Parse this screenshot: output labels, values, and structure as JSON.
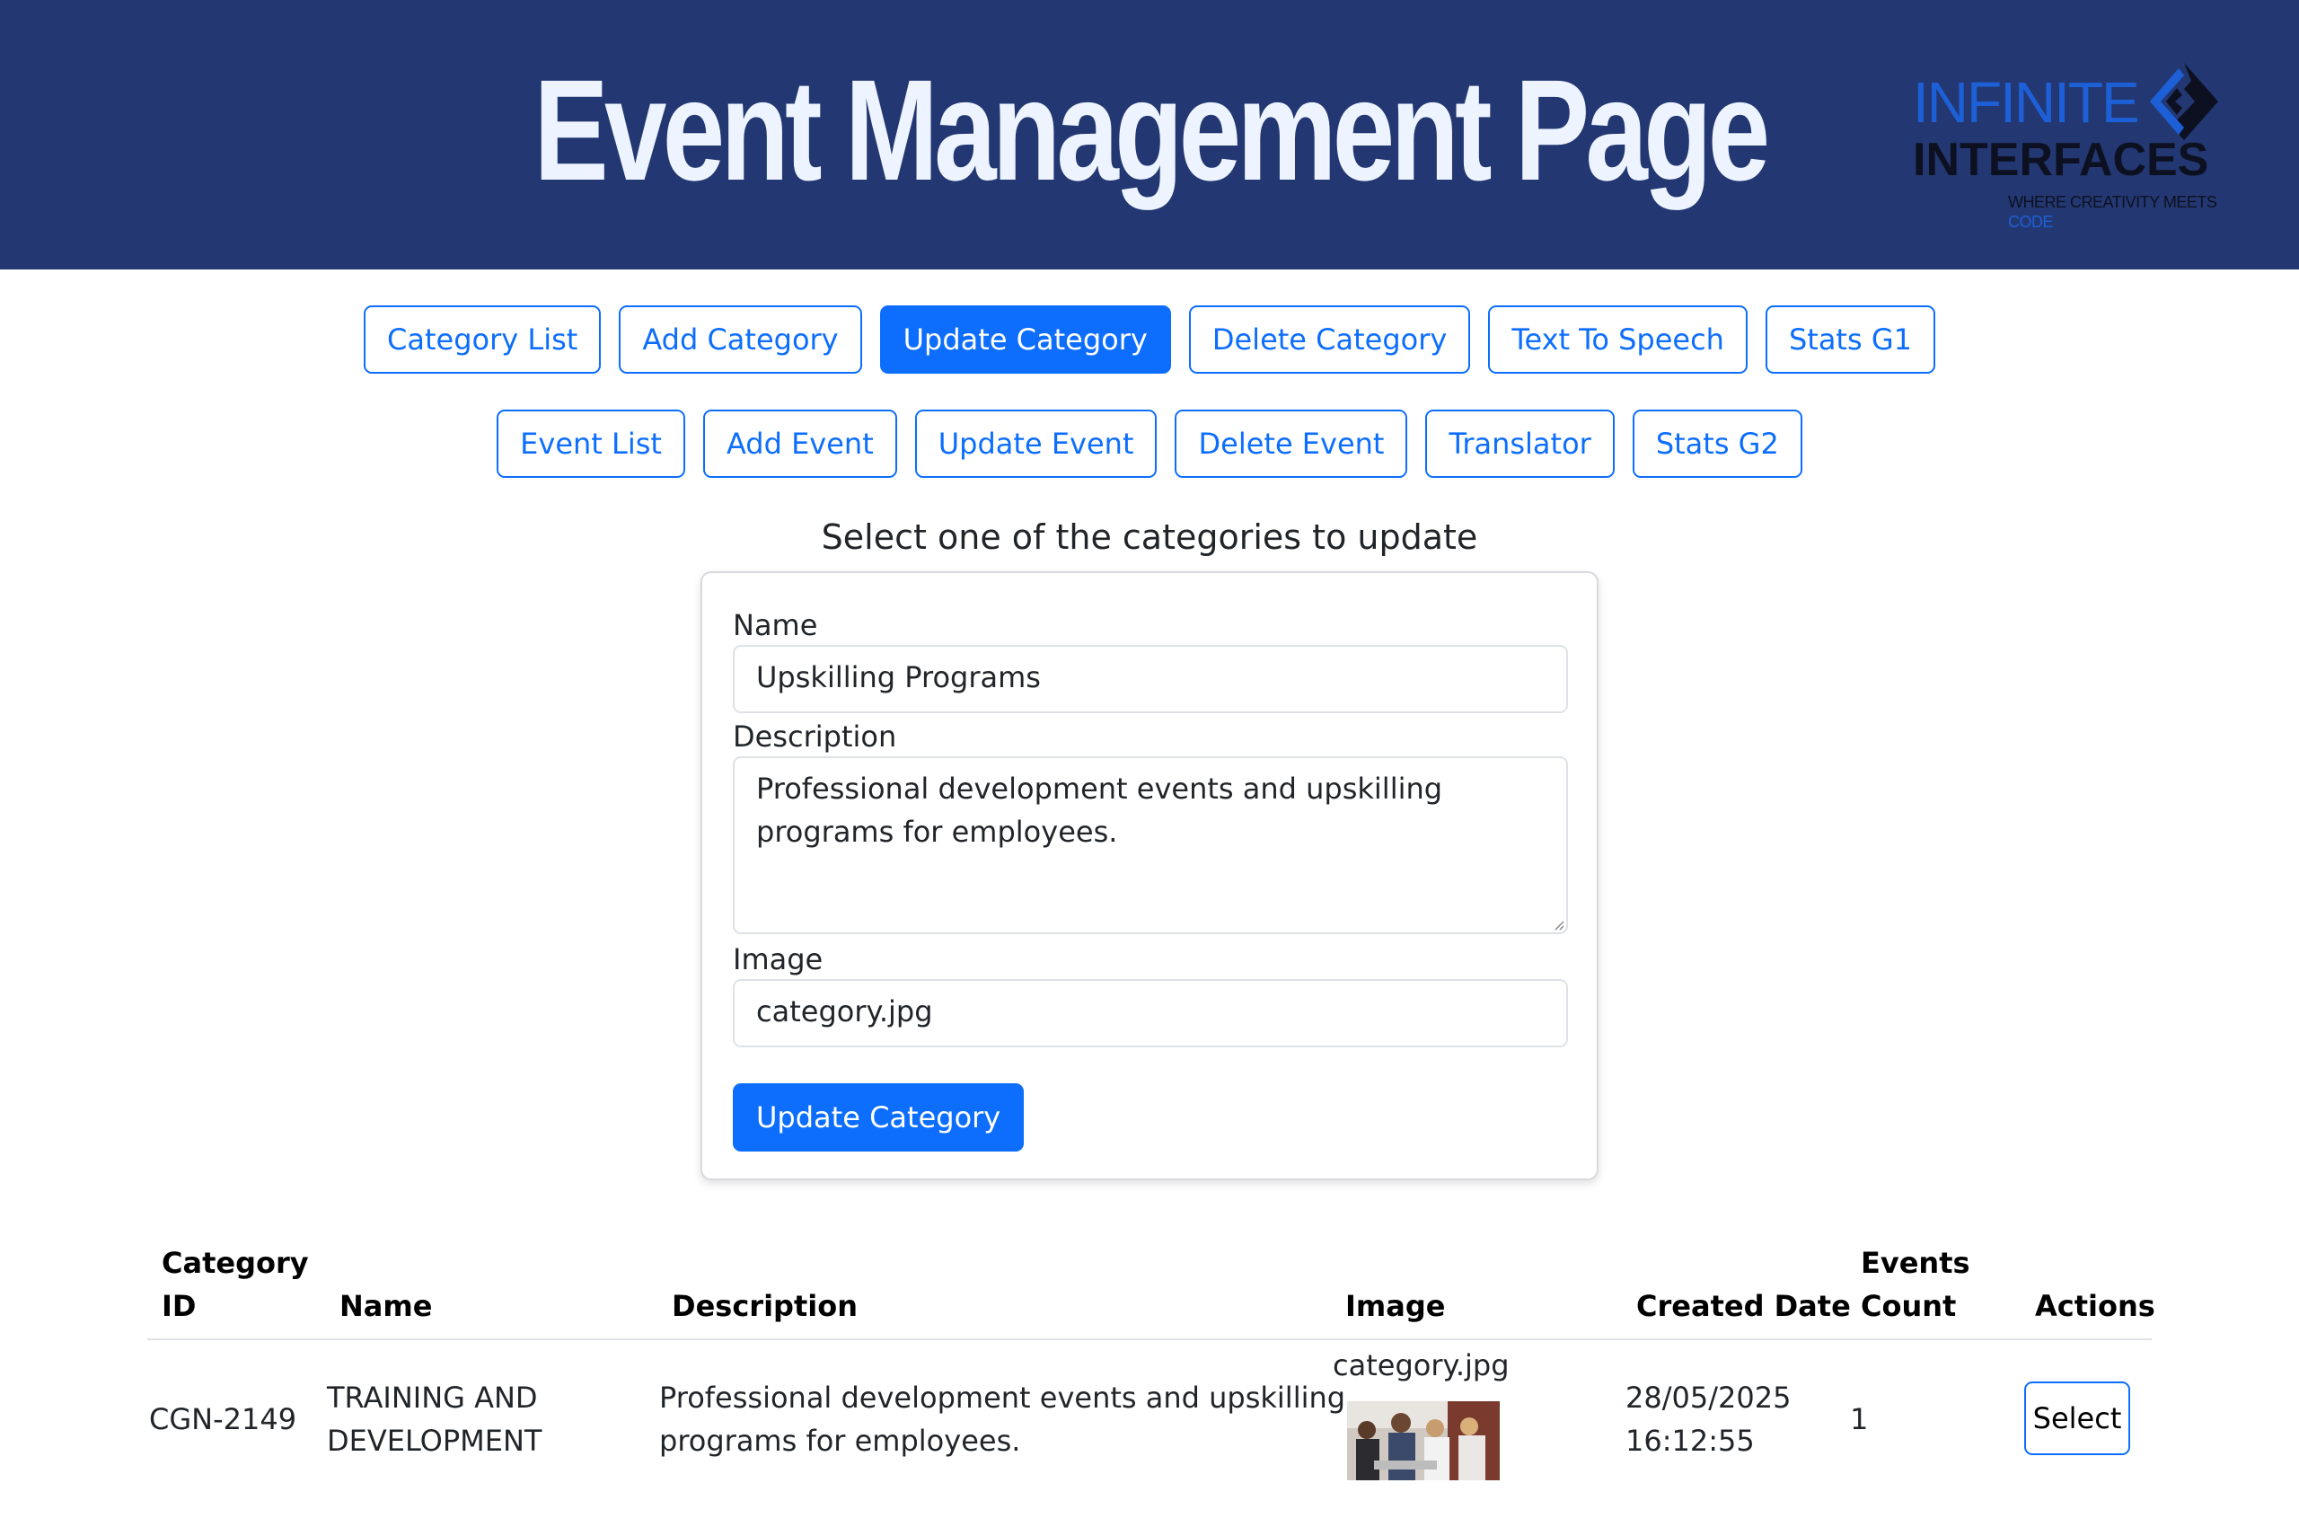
{
  "header": {
    "title": "Event Management Page",
    "logo": {
      "line1": "INFINITE",
      "line2": "INTERFACES",
      "tagline": "WHERE CREATIVITY MEETS",
      "tagline_accent": "CODE"
    }
  },
  "nav": {
    "row1": [
      "Category List",
      "Add Category",
      "Update Category",
      "Delete Category",
      "Text To Speech",
      "Stats G1"
    ],
    "row2": [
      "Event List",
      "Add Event",
      "Update Event",
      "Delete Event",
      "Translator",
      "Stats G2"
    ],
    "active": "Update Category"
  },
  "form": {
    "heading": "Select one of the categories to update",
    "name_label": "Name",
    "name_value": "Upskilling Programs",
    "description_label": "Description",
    "description_value": "Professional development events and upskilling programs for employees.",
    "image_label": "Image",
    "image_value": "category.jpg",
    "submit_label": "Update Category"
  },
  "table": {
    "headers": {
      "category_id_1": "Category",
      "category_id_2": "ID",
      "name": "Name",
      "description": "Description",
      "image": "Image",
      "created_date": "Created Date",
      "events_count_1": "Events",
      "events_count_2": "Count",
      "actions": "Actions"
    },
    "rows": [
      {
        "category_id": "CGN-2149",
        "name_1": "TRAINING AND",
        "name_2": "DEVELOPMENT",
        "description_1": "Professional development events and upskilling",
        "description_2": "programs for employees.",
        "image": "category.jpg",
        "created_date_1": "28/05/2025",
        "created_date_2": "16:12:55",
        "events_count": "1",
        "action_label": "Select"
      }
    ]
  },
  "colors": {
    "header_bg": "#233872",
    "primary": "#0d6efd",
    "logo_accent": "#1d5fd6"
  },
  "icons": [
    "logo-mark-icon",
    "resize-grip-icon"
  ]
}
